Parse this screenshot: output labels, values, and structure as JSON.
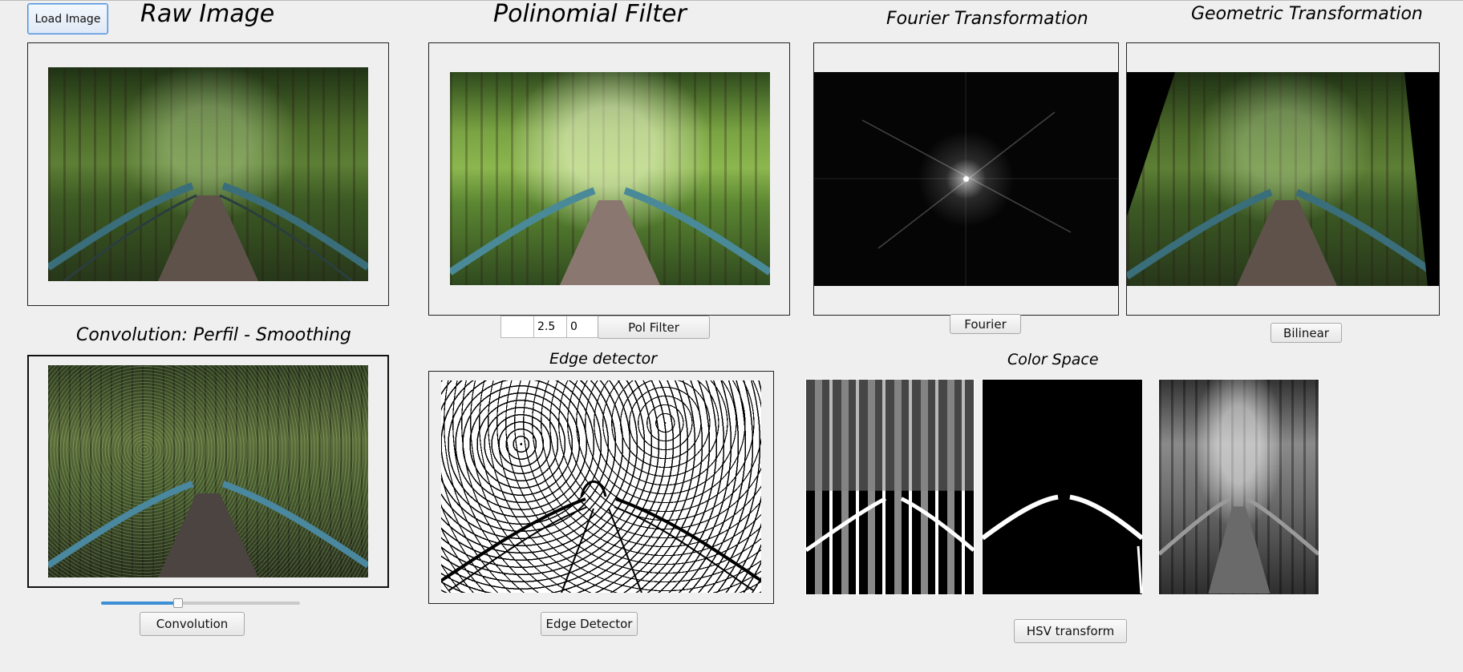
{
  "toolbar": {
    "load_image_label": "Load Image"
  },
  "panels": {
    "raw": {
      "title": "Raw Image"
    },
    "polynomial": {
      "title": "Polinomial Filter",
      "param_a": "",
      "param_b": "2.5",
      "param_c": "0",
      "button": "Pol Filter"
    },
    "fourier": {
      "title": "Fourier Transformation",
      "button": "Fourier"
    },
    "geometric": {
      "title": "Geometric Transformation",
      "button": "Bilinear"
    },
    "convolution": {
      "title": "Convolution: Perfil - Smoothing",
      "button": "Convolution",
      "slider_value_fraction": 0.38
    },
    "edge": {
      "title": "Edge detector",
      "button": "Edge Detector"
    },
    "color_space": {
      "title": "Color Space",
      "button": "HSV transform"
    }
  },
  "colors": {
    "background": "#efefef",
    "slider_accent": "#3d8fd6",
    "focus_border": "#4a90d9"
  }
}
